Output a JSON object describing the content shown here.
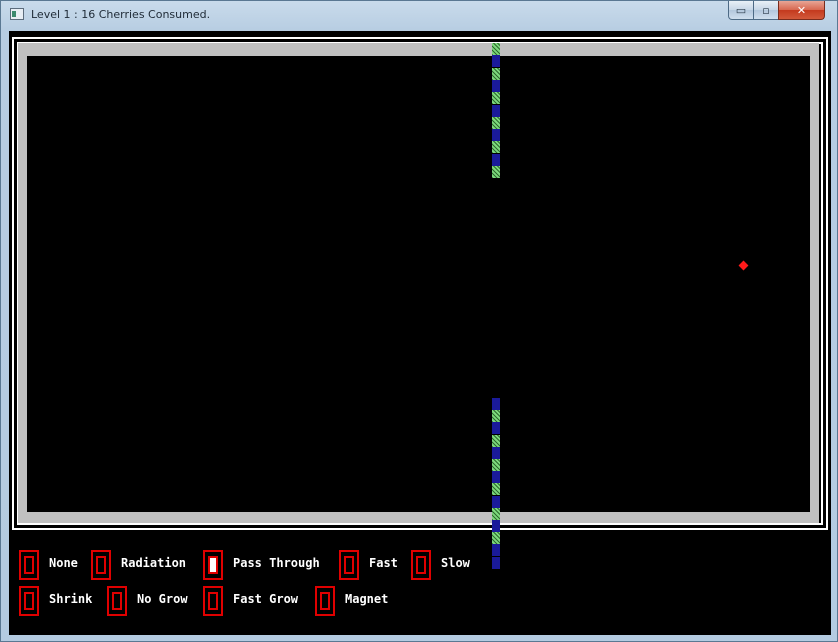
{
  "window": {
    "title": "Level 1 : 16 Cherries Consumed.",
    "minimize_glyph": "▭",
    "maximize_glyph": "▫",
    "close_glyph": "✕"
  },
  "game": {
    "level": 1,
    "cherries_consumed": 16,
    "colors": {
      "wall": "#c0c0c0",
      "arena": "#000000",
      "snake_green": "#7cd87c",
      "snake_blue": "#1a1a9a",
      "cherry": "#ff1a1a",
      "powerup_frame": "#e00000"
    }
  },
  "powerups": {
    "row1": [
      {
        "label": "None",
        "active": false
      },
      {
        "label": "Radiation",
        "active": false
      },
      {
        "label": "Pass Through",
        "active": true
      },
      {
        "label": "Fast",
        "active": false
      },
      {
        "label": "Slow",
        "active": false
      }
    ],
    "row2": [
      {
        "label": "Shrink",
        "active": false
      },
      {
        "label": "No Grow",
        "active": false
      },
      {
        "label": "Fast Grow",
        "active": false
      },
      {
        "label": "Magnet",
        "active": false
      }
    ]
  }
}
